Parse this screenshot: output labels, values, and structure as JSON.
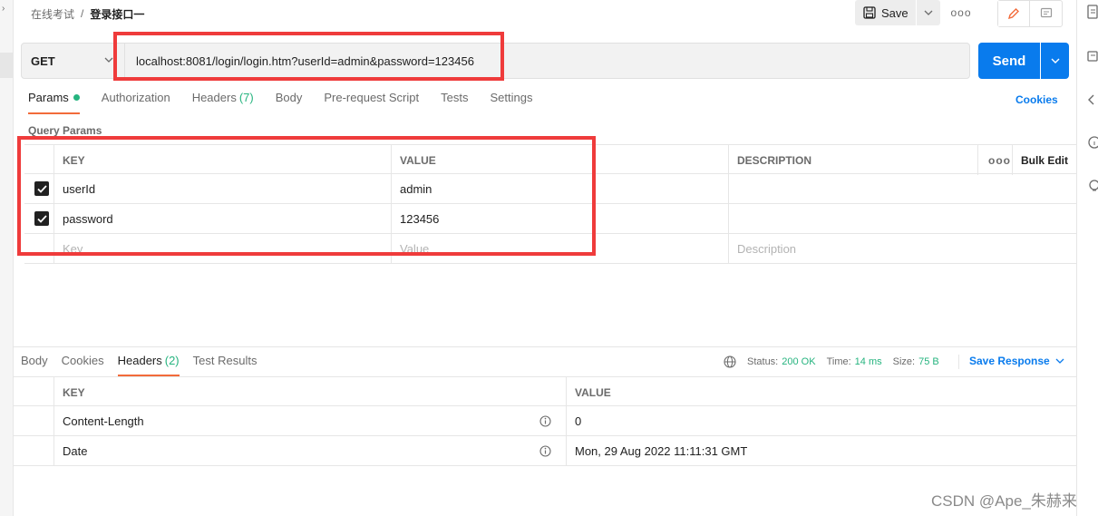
{
  "breadcrumb": {
    "parent": "在线考试",
    "separator": "/",
    "current": "登录接口一"
  },
  "toolbar": {
    "save_label": "Save",
    "more_label": "ooo"
  },
  "request": {
    "method": "GET",
    "url": "localhost:8081/login/login.htm?userId=admin&password=123456",
    "send_label": "Send"
  },
  "request_tabs": [
    {
      "label": "Params",
      "count": ""
    },
    {
      "label": "Authorization",
      "count": ""
    },
    {
      "label": "Headers",
      "count": "(7)"
    },
    {
      "label": "Body",
      "count": ""
    },
    {
      "label": "Pre-request Script",
      "count": ""
    },
    {
      "label": "Tests",
      "count": ""
    },
    {
      "label": "Settings",
      "count": ""
    }
  ],
  "cookies_label": "Cookies",
  "query_params": {
    "title": "Query Params",
    "headers": {
      "key": "KEY",
      "value": "VALUE",
      "description": "DESCRIPTION",
      "more": "ooo",
      "bulk_edit": "Bulk Edit"
    },
    "rows": [
      {
        "key": "userId",
        "value": "admin",
        "description": ""
      },
      {
        "key": "password",
        "value": "123456",
        "description": ""
      }
    ],
    "placeholders": {
      "key": "Key",
      "value": "Value",
      "description": "Description"
    }
  },
  "response_tabs": [
    {
      "label": "Body",
      "count": ""
    },
    {
      "label": "Cookies",
      "count": ""
    },
    {
      "label": "Headers",
      "count": "(2)"
    },
    {
      "label": "Test Results",
      "count": ""
    }
  ],
  "response_status": {
    "status_label": "Status:",
    "status_value": "200 OK",
    "time_label": "Time:",
    "time_value": "14 ms",
    "size_label": "Size:",
    "size_value": "75 B"
  },
  "save_response_label": "Save Response",
  "response_headers": {
    "headers": {
      "key": "KEY",
      "value": "VALUE"
    },
    "rows": [
      {
        "key": "Content-Length",
        "value": "0"
      },
      {
        "key": "Date",
        "value": "Mon, 29 Aug 2022 11:11:31 GMT"
      }
    ]
  },
  "watermark": "CSDN @Ape_朱赫来",
  "colors": {
    "accent": "#097bed",
    "tab_underline": "#f26b3a",
    "success": "#26b47f",
    "annotation": "#ef3b3b"
  }
}
